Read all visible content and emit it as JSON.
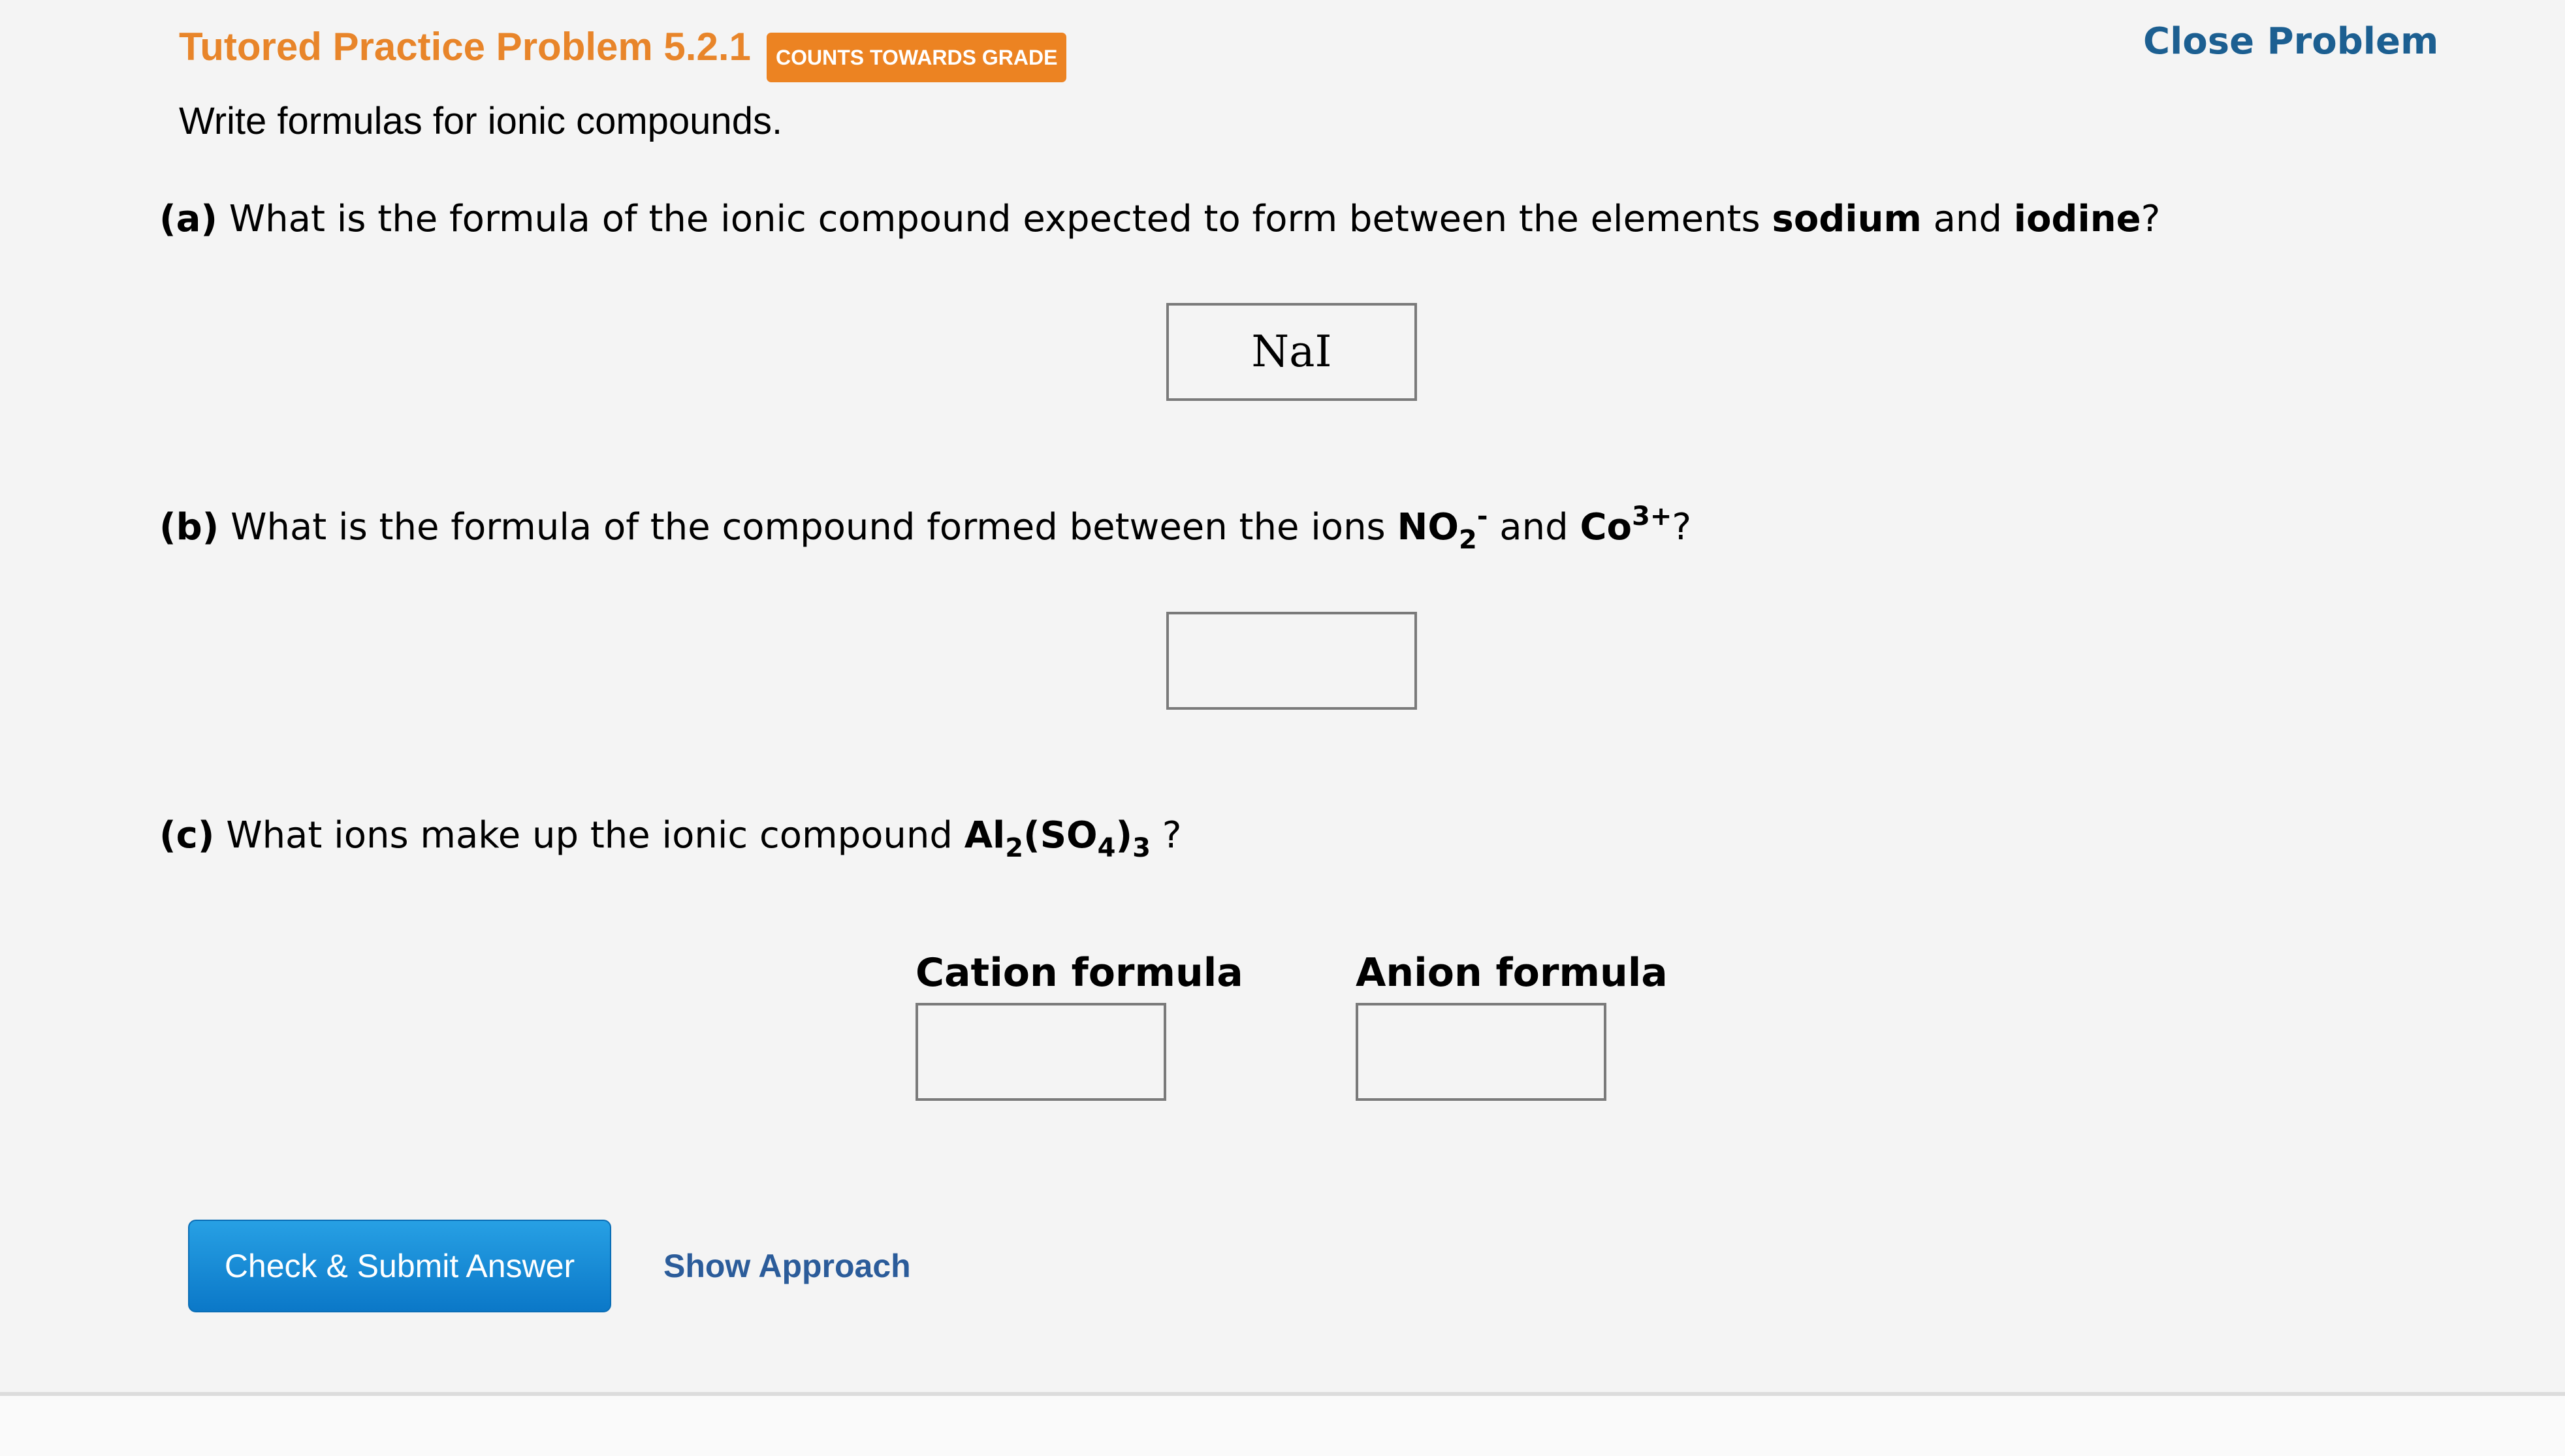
{
  "header": {
    "title": "Tutored Practice Problem 5.2.1",
    "badge": "COUNTS TOWARDS GRADE",
    "close_label": "Close Problem"
  },
  "instructions": "Write formulas for ionic compounds.",
  "part_a": {
    "label": "(a)",
    "text_1": " What is the formula of the ionic compound expected to form between the elements ",
    "element_1": "sodium",
    "text_2": " and ",
    "element_2": "iodine",
    "text_3": "?",
    "answer_value": "NaI"
  },
  "part_b": {
    "label": "(b)",
    "text_1": " What is the formula of the compound formed between the ions ",
    "ion_1_base": "NO",
    "ion_1_sub": "2",
    "ion_1_sup": "-",
    "text_2": " and ",
    "ion_2_base": "Co",
    "ion_2_sup": "3+",
    "text_3": "?",
    "answer_value": ""
  },
  "part_c": {
    "label": "(c)",
    "text_1": " What ions make up the ionic compound ",
    "f_1": "Al",
    "f_sub_1": "2",
    "f_2": "(SO",
    "f_sub_2": "4",
    "f_3": ")",
    "f_sub_3": "3",
    "text_2": " ?",
    "cation_label": "Cation formula",
    "anion_label": "Anion formula",
    "cation_value": "",
    "anion_value": ""
  },
  "footer": {
    "submit_label": "Check & Submit Answer",
    "approach_label": "Show Approach"
  },
  "colors": {
    "title": "#e8852a",
    "badge": "#ec8322",
    "close_link": "#1c5f91",
    "submit_button": "#1a8fd8",
    "approach_link": "#2b5c9a",
    "background": "#f4f4f4"
  }
}
